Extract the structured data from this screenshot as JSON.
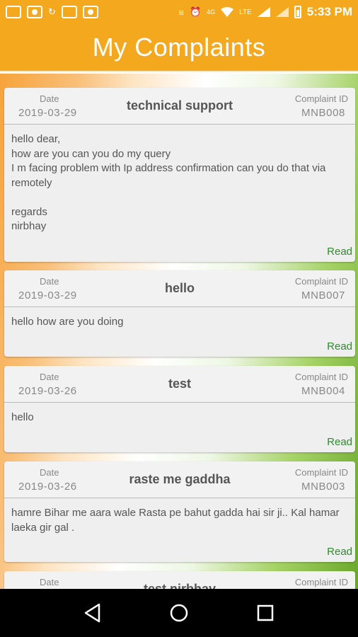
{
  "status_bar": {
    "network": "LTE",
    "data_type": "4G",
    "time": "5:33 PM"
  },
  "app_bar": {
    "title": "My Complaints"
  },
  "labels": {
    "date": "Date",
    "complaint_id": "Complaint ID",
    "read": "Read"
  },
  "complaints": [
    {
      "date": "2019-03-29",
      "title": "technical support",
      "id": "MNB008",
      "message": "hello dear,\nhow are you can you do my query\nI m facing problem with Ip address confirmation can you do that via remotely\n\nregards\nnirbhay"
    },
    {
      "date": "2019-03-29",
      "title": "hello",
      "id": "MNB007",
      "message": "hello how are you doing"
    },
    {
      "date": "2019-03-26",
      "title": "test",
      "id": "MNB004",
      "message": "hello"
    },
    {
      "date": "2019-03-26",
      "title": "raste me gaddha",
      "id": "MNB003",
      "message": "hamre Bihar me aara wale Rasta pe bahut gadda hai sir ji.. Kal hamar laeka gir gal ."
    },
    {
      "date": "",
      "title": "test nirbhay",
      "id": "",
      "message": ""
    }
  ],
  "colors": {
    "accent": "#f4a81d",
    "read_link": "#2e8b2e"
  },
  "icons": [
    "message-icon",
    "camera-icon",
    "sync-icon",
    "news-icon",
    "camera-icon",
    "vibrate-icon",
    "alarm-icon",
    "wifi-call-icon",
    "wifi-icon",
    "signal-icon",
    "signal-icon",
    "battery-icon",
    "back-icon",
    "home-icon",
    "recents-icon"
  ]
}
